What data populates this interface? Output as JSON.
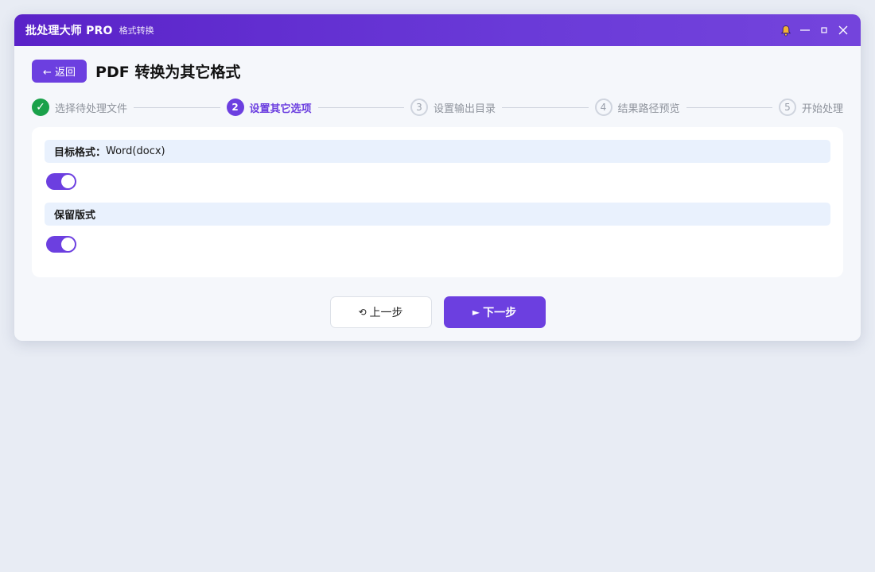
{
  "titlebar": {
    "app_name": "批处理大师 PRO",
    "subtitle": "格式转换",
    "icons": [
      "bell-icon",
      "minimize-icon",
      "maximize-icon",
      "close-icon"
    ]
  },
  "header": {
    "back_label": "← 返回",
    "title": "PDF 转换为其它格式"
  },
  "steps": [
    {
      "number": "✓",
      "label": "选择待处理文件",
      "state": "done"
    },
    {
      "number": "2",
      "label": "设置其它选项",
      "state": "active"
    },
    {
      "number": "3",
      "label": "设置输出目录",
      "state": "pending"
    },
    {
      "number": "4",
      "label": "结果路径预览",
      "state": "pending"
    },
    {
      "number": "5",
      "label": "开始处理",
      "state": "pending"
    }
  ],
  "options": {
    "target_format_label": "目标格式：",
    "target_format_value": "Word(docx)",
    "target_format_toggle": true,
    "keep_layout_label": "保留版式",
    "keep_layout_toggle": true
  },
  "nav": {
    "prev_icon": "⟲",
    "prev_label": "上一步",
    "next_icon": "►",
    "next_label": "下一步"
  },
  "colors": {
    "accent": "#6c3fe0",
    "titlebar_start": "#5a22c8",
    "done_green": "#1aa14a",
    "option_header_bg": "#e9f1fd"
  }
}
